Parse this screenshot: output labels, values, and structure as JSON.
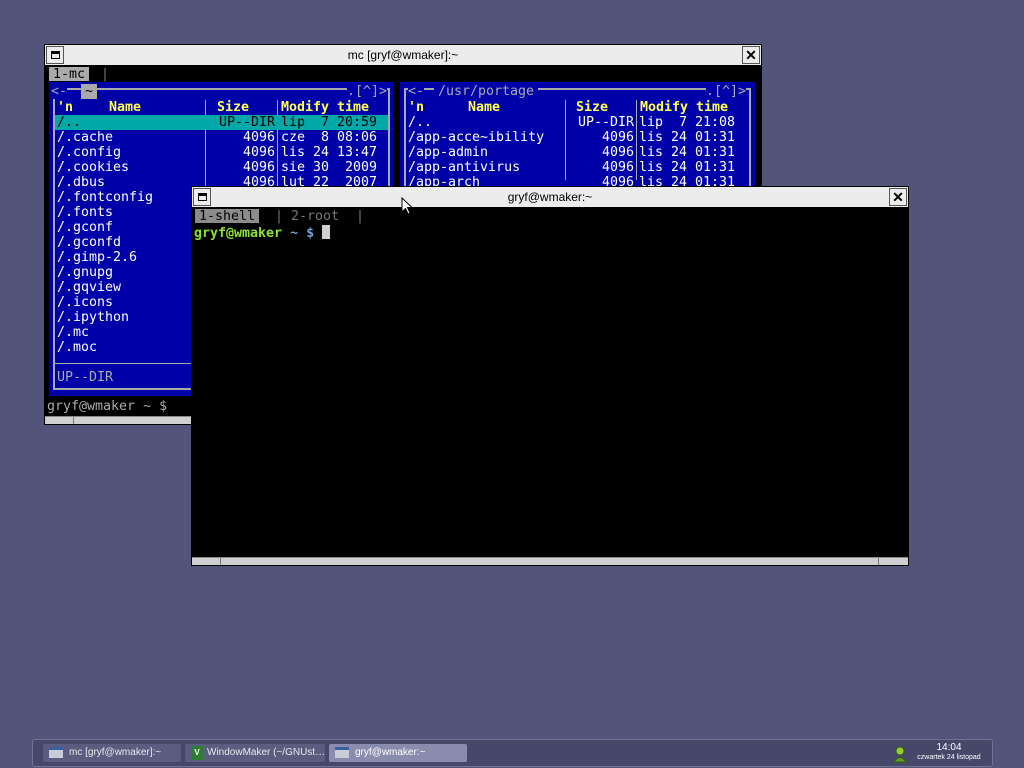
{
  "mc_window": {
    "title": "mc [gryf@wmaker]:~",
    "tab_active": "1-mc",
    "left_panel": {
      "path": "~",
      "top_right": ".[^]>",
      "corner_left": "<-",
      "headers": {
        "n": "'n",
        "name": "Name",
        "size": "Size",
        "mtime": "Modify time"
      },
      "rows": [
        {
          "name": "/..",
          "size": "UP--DIR",
          "time": "lip  7 20:59"
        },
        {
          "name": "/.cache",
          "size": "4096",
          "time": "cze  8 08:06"
        },
        {
          "name": "/.config",
          "size": "4096",
          "time": "lis 24 13:47"
        },
        {
          "name": "/.cookies",
          "size": "4096",
          "time": "sie 30  2009"
        },
        {
          "name": "/.dbus",
          "size": "4096",
          "time": "lut 22  2007"
        },
        {
          "name": "/.fontconfig",
          "size": "",
          "time": ""
        },
        {
          "name": "/.fonts",
          "size": "",
          "time": ""
        },
        {
          "name": "/.gconf",
          "size": "",
          "time": ""
        },
        {
          "name": "/.gconfd",
          "size": "",
          "time": ""
        },
        {
          "name": "/.gimp-2.6",
          "size": "",
          "time": ""
        },
        {
          "name": "/.gnupg",
          "size": "",
          "time": ""
        },
        {
          "name": "/.gqview",
          "size": "",
          "time": ""
        },
        {
          "name": "/.icons",
          "size": "",
          "time": ""
        },
        {
          "name": "/.ipython",
          "size": "",
          "time": ""
        },
        {
          "name": "/.mc",
          "size": "",
          "time": ""
        },
        {
          "name": "/.moc",
          "size": "",
          "time": ""
        }
      ],
      "status": "UP--DIR"
    },
    "right_panel": {
      "path": "/usr/portage",
      "top_right": ".[^]>",
      "corner_left": "<-",
      "headers": {
        "n": "'n",
        "name": "Name",
        "size": "Size",
        "mtime": "Modify time"
      },
      "rows": [
        {
          "name": "/..",
          "size": "UP--DIR",
          "time": "lip  7 21:08"
        },
        {
          "name": "/app-acce~ibility",
          "size": "4096",
          "time": "lis 24 01:31"
        },
        {
          "name": "/app-admin",
          "size": "4096",
          "time": "lis 24 01:31"
        },
        {
          "name": "/app-antivirus",
          "size": "4096",
          "time": "lis 24 01:31"
        },
        {
          "name": "/app-arch",
          "size": "4096",
          "time": "lis 24 01:31"
        }
      ]
    },
    "prompt": "gryf@wmaker ~ $"
  },
  "shell_window": {
    "title": "gryf@wmaker:~",
    "tabs": [
      "1-shell",
      "2-root"
    ],
    "prompt_user": "gryf@wmaker",
    "prompt_path": "~",
    "prompt_symbol": "$"
  },
  "taskbar": {
    "tasks": [
      {
        "label": "mc [gryf@wmaker]:~",
        "icon": "terminal-icon"
      },
      {
        "label": "WindowMaker (~/GNUst…",
        "icon": "vim-icon"
      },
      {
        "label": "gryf@wmaker:~",
        "icon": "terminal-icon"
      }
    ],
    "clock_time": "14:04",
    "clock_date": "czwartek 24 listopad"
  },
  "colors": {
    "desktop": "#525479",
    "mc_panel": "#0000a8",
    "mc_header": "#ffff55",
    "selection": "#00a8a8",
    "prompt_green": "#8ae234",
    "prompt_blue": "#729fcf"
  }
}
